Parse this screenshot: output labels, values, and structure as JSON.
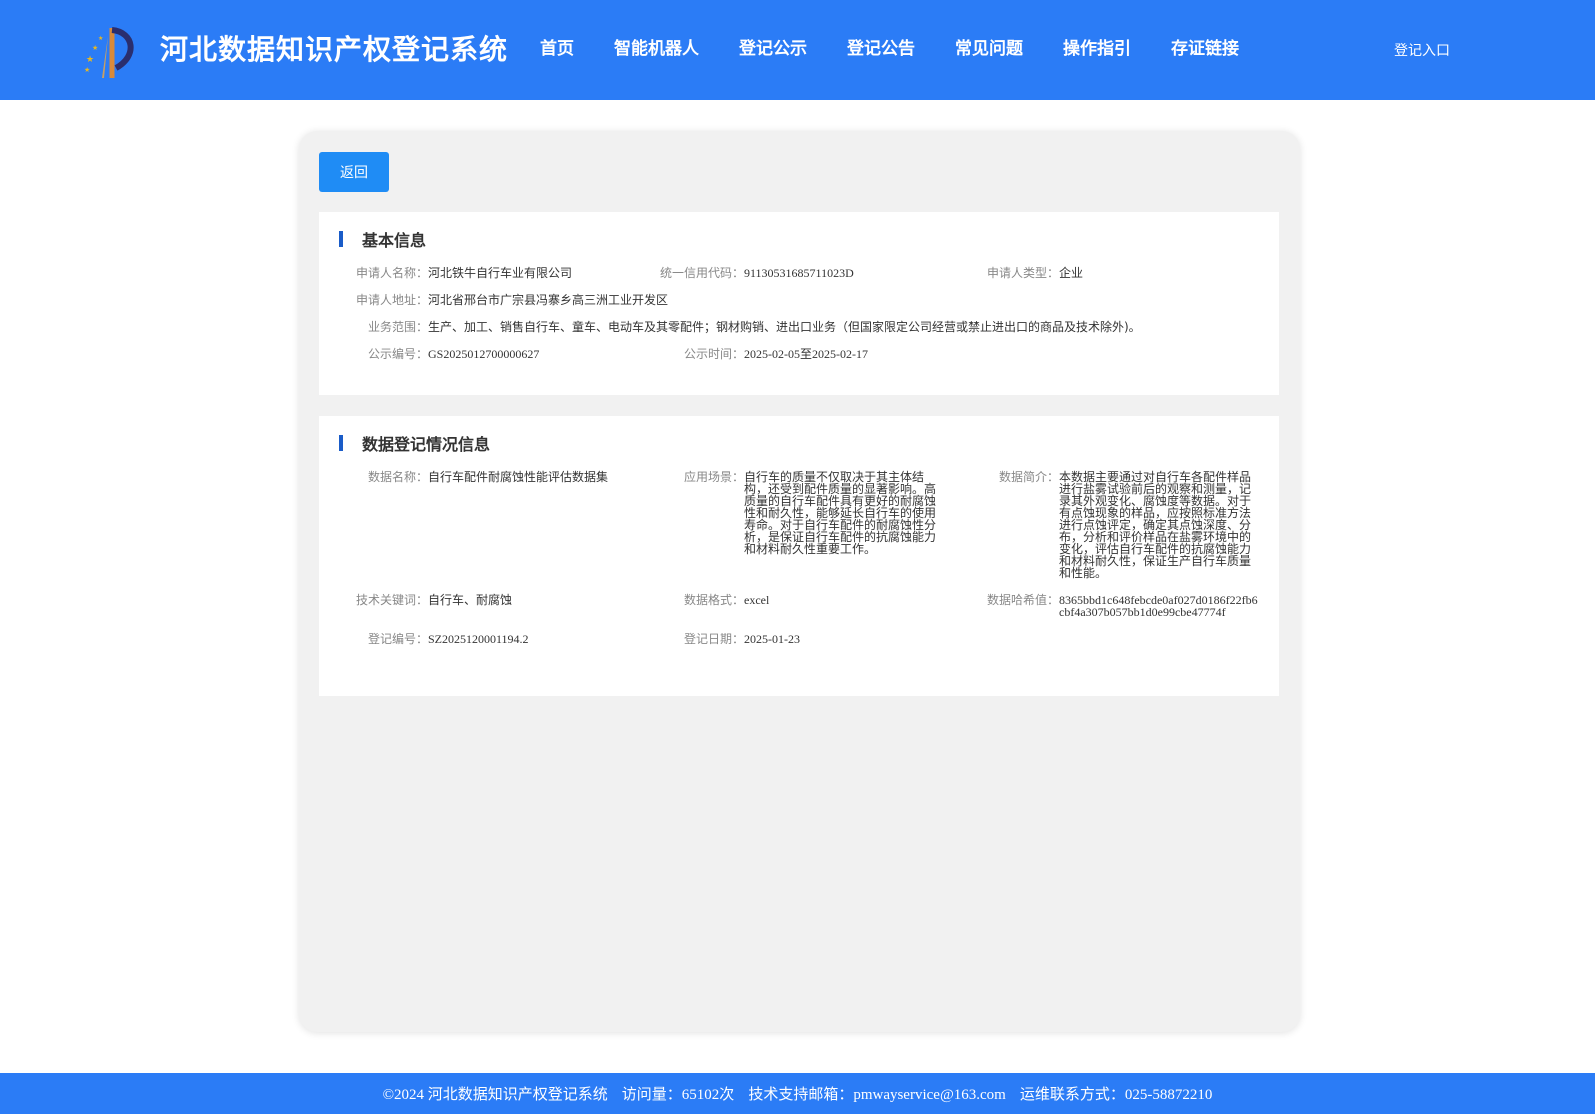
{
  "header": {
    "site_title": "河北数据知识产权登记系统",
    "nav": [
      "首页",
      "智能机器人",
      "登记公示",
      "登记公告",
      "常见问题",
      "操作指引",
      "存证链接"
    ],
    "login": "登记入口",
    "bg_color": "#2b7cf6"
  },
  "back_button": "返回",
  "basic": {
    "title": "基本信息",
    "applicant_name_label": "申请人名称：",
    "applicant_name": "河北铁牛自行车业有限公司",
    "credit_code_label": "统一信用代码：",
    "credit_code": "91130531685711023D",
    "applicant_type_label": "申请人类型：",
    "applicant_type": "企业",
    "address_label": "申请人地址：",
    "address": "河北省邢台市广宗县冯寨乡高三洲工业开发区",
    "scope_label": "业务范围：",
    "scope": "生产、加工、销售自行车、童车、电动车及其零配件；钢材购销、进出口业务（但国家限定公司经营或禁止进出口的商品及技术除外)。",
    "notice_no_label": "公示编号：",
    "notice_no": "GS2025012700000627",
    "notice_time_label": "公示时间：",
    "notice_time": "2025-02-05至2025-02-17"
  },
  "data_reg": {
    "title": "数据登记情况信息",
    "data_name_label": "数据名称：",
    "data_name": "自行车配件耐腐蚀性能评估数据集",
    "scenario_label": "应用场景：",
    "scenario": "自行车的质量不仅取决于其主体结构，还受到配件质量的显著影响。高质量的自行车配件具有更好的耐腐蚀性和耐久性，能够延长自行车的使用寿命。对于自行车配件的耐腐蚀性分析，是保证自行车配件的抗腐蚀能力和材料耐久性重要工作。",
    "intro_label": "数据简介：",
    "intro": "本数据主要通过对自行车各配件样品进行盐雾试验前后的观察和测量，记录其外观变化、腐蚀度等数据。对于有点蚀现象的样品，应按照标准方法进行点蚀评定，确定其点蚀深度、分布，分析和评价样品在盐雾环境中的变化，评估自行车配件的抗腐蚀能力和材料耐久性，保证生产自行车质量和性能。",
    "keywords_label": "技术关键词：",
    "keywords": "自行车、耐腐蚀",
    "format_label": "数据格式：",
    "format": "excel",
    "hash_label": "数据哈希值：",
    "hash": "8365bbd1c648febcde0af027d0186f22fb6cbf4a307b057bb1d0e99cbe47774f",
    "reg_no_label": "登记编号：",
    "reg_no": "SZ2025120001194.2",
    "reg_date_label": "登记日期：",
    "reg_date": "2025-01-23"
  },
  "footer": {
    "copyright": "©2024 河北数据知识产权登记系统",
    "visits": "访问量：65102次",
    "email": "技术支持邮箱：pmwayservice@163.com",
    "phone": "运维联系方式：025-58872210"
  }
}
